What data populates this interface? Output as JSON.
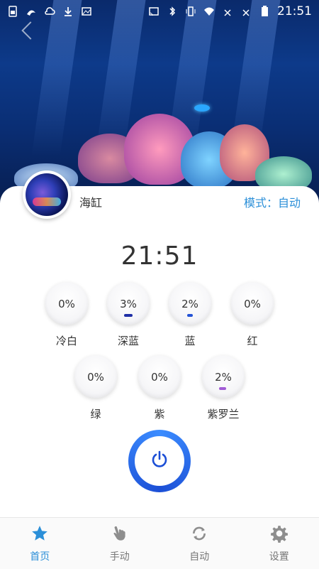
{
  "status_bar": {
    "time": "21:51",
    "icons": [
      "sim-card-icon",
      "uc-browser-icon",
      "weather-icon",
      "download-icon",
      "image-icon",
      "cast-icon",
      "bluetooth-icon",
      "vibrate-icon",
      "wifi-icon",
      "signal-off-icon",
      "signal-off-icon",
      "battery-icon"
    ]
  },
  "header": {
    "tank_name": "海缸",
    "mode_label": "模式：自动",
    "accent_color": "#2b8fd8"
  },
  "clock": "21:51",
  "channels_row1": [
    {
      "label": "冷白",
      "value": "0%",
      "level": 0,
      "bar_color": "#cfcfcf"
    },
    {
      "label": "深蓝",
      "value": "3%",
      "level": 3,
      "bar_color": "#1f2fa6"
    },
    {
      "label": "蓝",
      "value": "2%",
      "level": 2,
      "bar_color": "#2453d6"
    },
    {
      "label": "红",
      "value": "0%",
      "level": 0,
      "bar_color": "#cfcfcf"
    }
  ],
  "channels_row2": [
    {
      "label": "绿",
      "value": "0%",
      "level": 0,
      "bar_color": "#cfcfcf"
    },
    {
      "label": "紫",
      "value": "0%",
      "level": 0,
      "bar_color": "#cfcfcf"
    },
    {
      "label": "紫罗兰",
      "value": "2%",
      "level": 2,
      "bar_color": "#a25cd6"
    }
  ],
  "power": {
    "icon": "power-icon",
    "color": "#1c4fd6"
  },
  "bottom_nav": [
    {
      "label": "首页",
      "icon": "star-icon",
      "active": true
    },
    {
      "label": "手动",
      "icon": "hand-icon",
      "active": false
    },
    {
      "label": "自动",
      "icon": "refresh-icon",
      "active": false
    },
    {
      "label": "设置",
      "icon": "gear-icon",
      "active": false
    }
  ]
}
